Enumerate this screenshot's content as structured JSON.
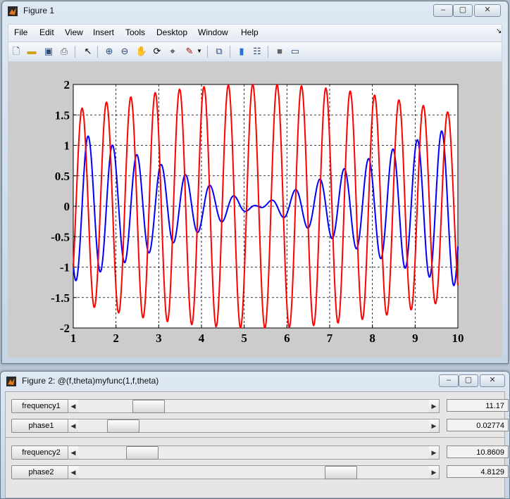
{
  "figure1": {
    "title": "Figure 1",
    "menu": [
      "File",
      "Edit",
      "View",
      "Insert",
      "Tools",
      "Desktop",
      "Window",
      "Help"
    ],
    "toolbar_icons": [
      "new-figure-icon",
      "open-file-icon",
      "save-icon",
      "print-icon",
      "pointer-icon",
      "zoom-in-icon",
      "zoom-out-icon",
      "pan-icon",
      "rotate-3d-icon",
      "data-cursor-icon",
      "brush-icon",
      "brush-dropdown-icon",
      "link-plot-icon",
      "colorbar-icon",
      "legend-icon",
      "hide-plot-tools-icon",
      "show-plot-tools-icon"
    ]
  },
  "figure2": {
    "title": "Figure 2: @(f,theta)myfunc(1,f,theta)",
    "controls": [
      {
        "label": "frequency1",
        "value": "11.17",
        "position": 0.17
      },
      {
        "label": "phase1",
        "value": "0.02774",
        "position": 0.09
      },
      {
        "label": "frequency2",
        "value": "10.8609",
        "position": 0.15
      },
      {
        "label": "phase2",
        "value": "4.8129",
        "position": 0.77
      }
    ]
  },
  "chart_data": {
    "type": "line",
    "xlim": [
      1,
      10
    ],
    "ylim": [
      -2,
      2
    ],
    "xticks": [
      "1",
      "2",
      "3",
      "4",
      "5",
      "6",
      "7",
      "8",
      "9",
      "10"
    ],
    "yticks": [
      "2",
      "1.5",
      "1",
      "0.5",
      "0",
      "-0.5",
      "-1",
      "-1.5",
      "-2"
    ],
    "grid": "dashed",
    "series": [
      {
        "color": "#0000ff",
        "f": 11.17,
        "theta": 0.02774,
        "f2": 10.8609,
        "theta2": 4.8129,
        "kind": "sum"
      },
      {
        "color": "#ff0000",
        "f": 11.17,
        "theta": 0.02774,
        "f2": 10.8609,
        "theta2": 4.8129,
        "kind": "diff"
      }
    ]
  }
}
